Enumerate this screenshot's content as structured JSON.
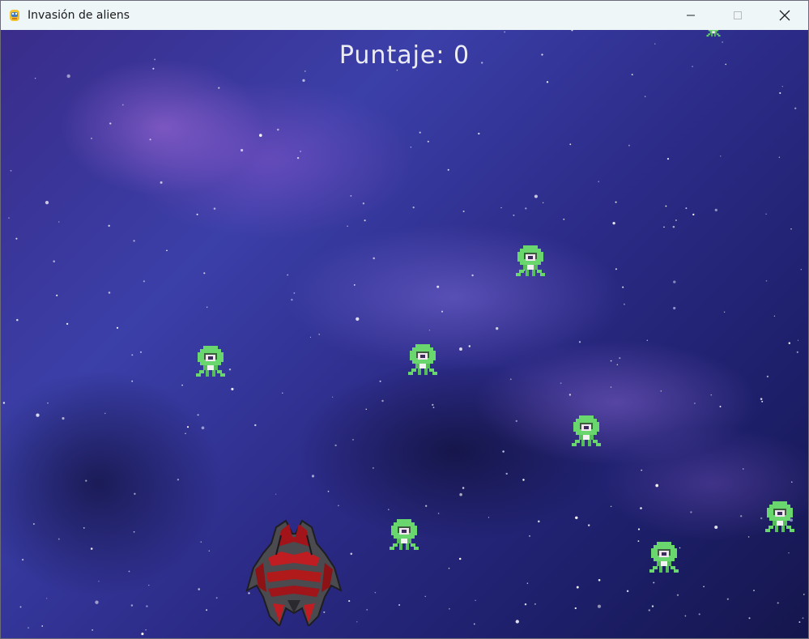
{
  "window": {
    "title": "Invasión de aliens",
    "app_icon": "pygame-snake-icon",
    "controls": [
      "minimize-icon",
      "maximize-icon",
      "close-icon"
    ]
  },
  "game": {
    "score_text": "Puntaje: 0",
    "background": "purple-nebula-starfield",
    "player": {
      "sprite": "red-dark-spaceship"
    },
    "enemies": [
      {
        "sprite": "green-alien"
      },
      {
        "sprite": "green-alien"
      },
      {
        "sprite": "green-alien"
      },
      {
        "sprite": "green-alien"
      },
      {
        "sprite": "green-alien"
      },
      {
        "sprite": "green-alien"
      },
      {
        "sprite": "green-alien"
      },
      {
        "sprite": "green-alien"
      }
    ]
  },
  "colors": {
    "titlebar": "#eef6f8",
    "alien_green": "#6ad66e",
    "ship_red": "#b11a1a",
    "score_text": "#ececf5"
  }
}
